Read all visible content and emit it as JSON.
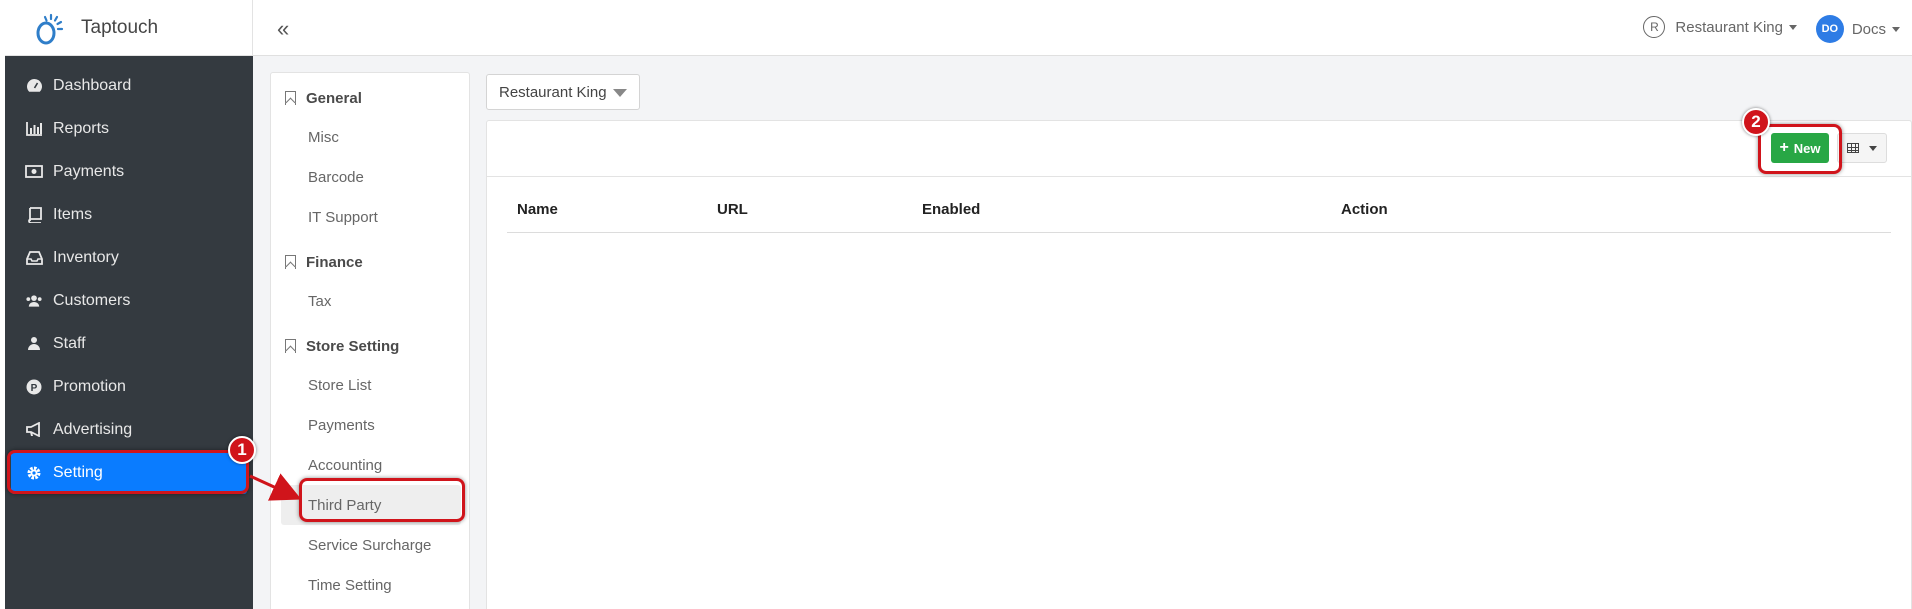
{
  "brand": {
    "name": "Taptouch"
  },
  "sidebar": {
    "items": [
      {
        "label": "Dashboard",
        "icon": "dashboard-icon"
      },
      {
        "label": "Reports",
        "icon": "bar-chart-icon"
      },
      {
        "label": "Payments",
        "icon": "money-icon"
      },
      {
        "label": "Items",
        "icon": "book-icon"
      },
      {
        "label": "Inventory",
        "icon": "inbox-icon"
      },
      {
        "label": "Customers",
        "icon": "users-icon"
      },
      {
        "label": "Staff",
        "icon": "staff-icon"
      },
      {
        "label": "Promotion",
        "icon": "promotion-icon"
      },
      {
        "label": "Advertising",
        "icon": "megaphone-icon"
      },
      {
        "label": "Setting",
        "icon": "gear-icon",
        "active": true
      }
    ]
  },
  "topbar": {
    "collapse_icon": "«",
    "store_label": "Restaurant King",
    "store_icon_letter": "R",
    "avatar_initials": "DO",
    "user_label": "Docs"
  },
  "submenu": {
    "sections": [
      {
        "title": "General",
        "items": [
          "Misc",
          "Barcode",
          "IT Support"
        ]
      },
      {
        "title": "Finance",
        "items": [
          "Tax"
        ]
      },
      {
        "title": "Store Setting",
        "items": [
          "Store List",
          "Payments",
          "Accounting",
          "Third Party",
          "Service Surcharge",
          "Time Setting"
        ]
      }
    ],
    "highlighted": "Third Party"
  },
  "content": {
    "store_dropdown": "Restaurant King",
    "new_button": "New",
    "columns": [
      "Name",
      "URL",
      "Enabled",
      "Action"
    ]
  },
  "annotations": {
    "step1": "1",
    "step2": "2"
  },
  "colors": {
    "sidebar_bg": "#343a40",
    "active": "#0a7cff",
    "new_btn": "#28a745",
    "annotation": "#d0141b"
  }
}
